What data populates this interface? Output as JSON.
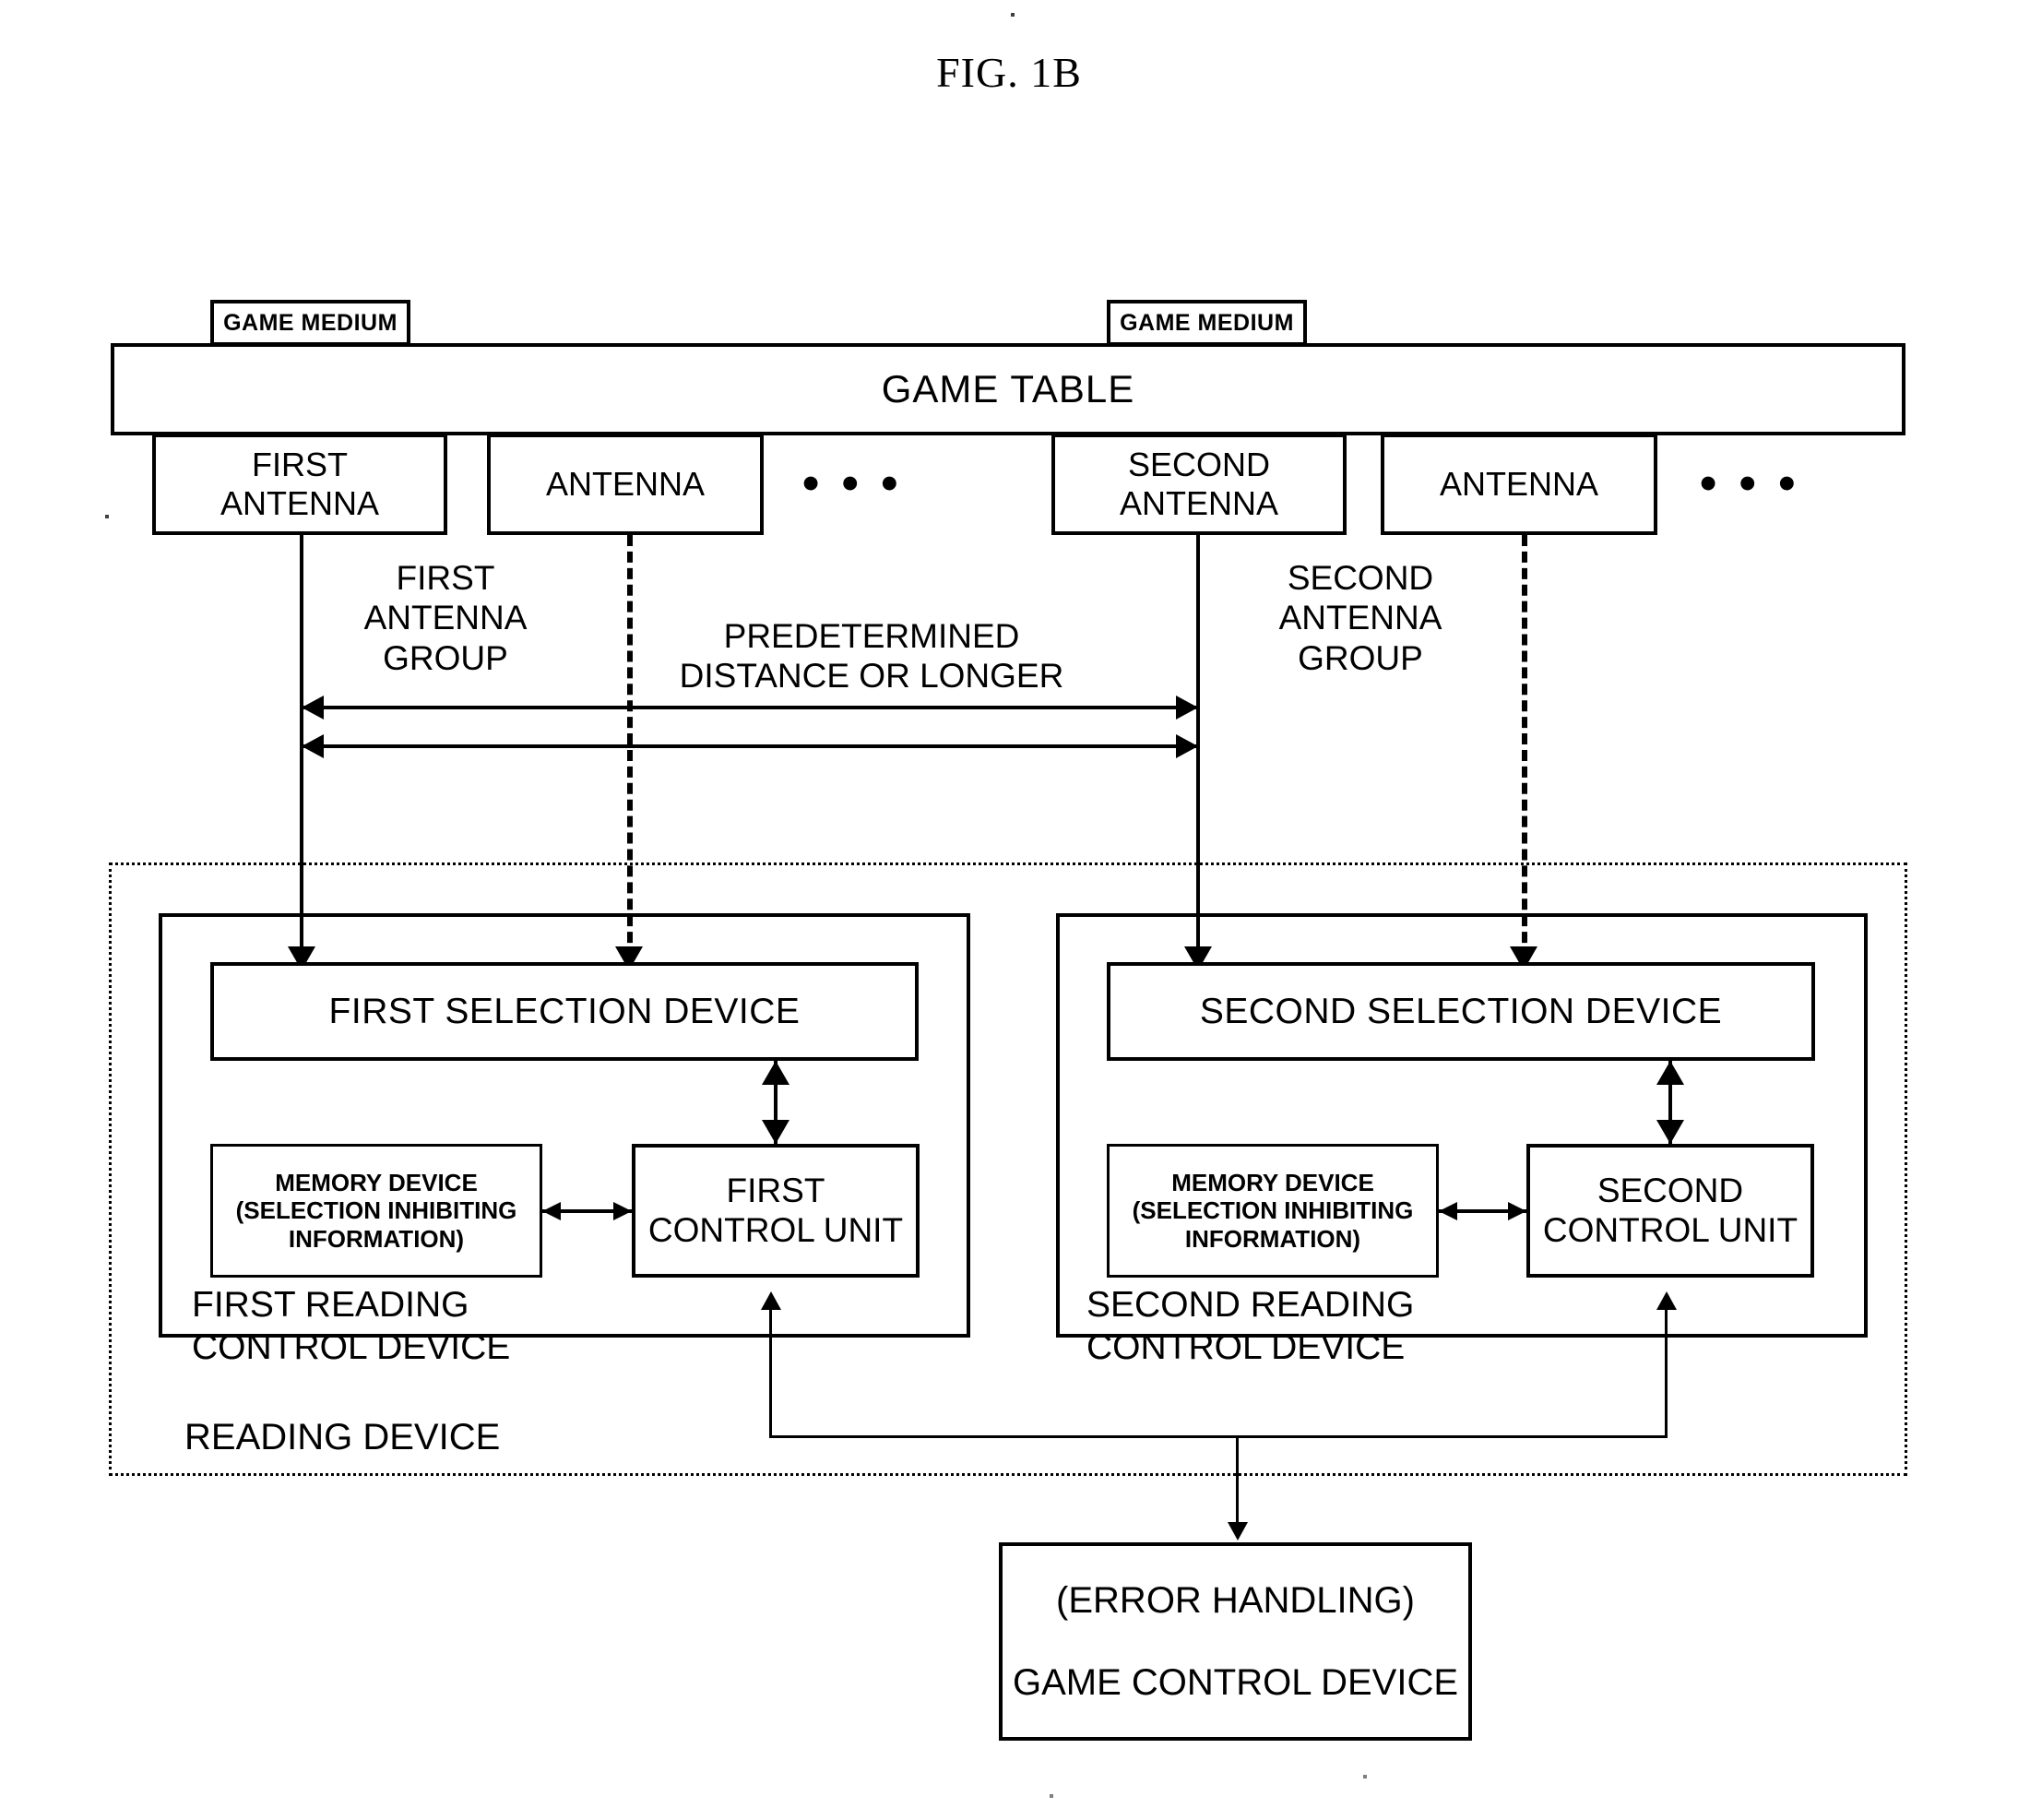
{
  "figure": {
    "title": "FIG. 1B",
    "type": "patent-block-diagram"
  },
  "game_media": [
    {
      "label": "GAME MEDIUM"
    },
    {
      "label": "GAME MEDIUM"
    }
  ],
  "game_table": {
    "label": "GAME TABLE"
  },
  "antennas": [
    {
      "label": "FIRST\nANTENNA",
      "group": "first"
    },
    {
      "label": "ANTENNA",
      "group": "first"
    },
    {
      "label": "SECOND\nANTENNA",
      "group": "second"
    },
    {
      "label": "ANTENNA",
      "group": "second"
    }
  ],
  "ellipsis": {
    "first_group": "• • •",
    "second_group": "• • •"
  },
  "group_labels": {
    "first": "FIRST\nANTENNA\nGROUP",
    "second": "SECOND\nANTENNA\nGROUP"
  },
  "distance_label": "PREDETERMINED\nDISTANCE OR LONGER",
  "reading_device": {
    "label": "READING DEVICE"
  },
  "first_reading_control_device": {
    "label": "FIRST READING\nCONTROL DEVICE",
    "selection_device": "FIRST SELECTION DEVICE",
    "memory_device": "MEMORY DEVICE\n(SELECTION INHIBITING\nINFORMATION)",
    "control_unit": "FIRST\nCONTROL UNIT"
  },
  "second_reading_control_device": {
    "label": "SECOND READING\nCONTROL DEVICE",
    "selection_device": "SECOND SELECTION DEVICE",
    "memory_device": "MEMORY DEVICE\n(SELECTION INHIBITING\nINFORMATION)",
    "control_unit": "SECOND\nCONTROL UNIT"
  },
  "game_control_device": {
    "line1": "(ERROR HANDLING)",
    "line2": "GAME CONTROL DEVICE"
  },
  "colors": {
    "ink": "#000000",
    "paper": "#ffffff"
  }
}
